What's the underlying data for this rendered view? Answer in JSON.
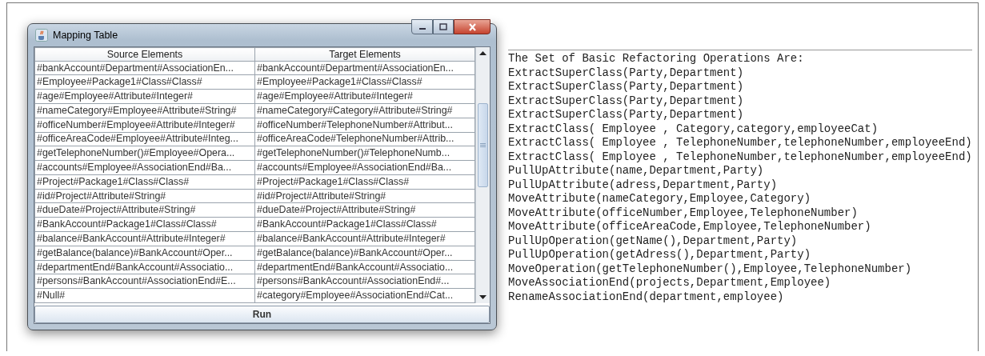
{
  "window": {
    "title": "Mapping Table"
  },
  "table": {
    "columns": [
      "Source Elements",
      "Target Elements"
    ],
    "rows": [
      [
        "#bankAccount#Department#AssociationEn...",
        "#bankAccount#Department#AssociationEn..."
      ],
      [
        "#Employee#Package1#Class#Class#",
        "#Employee#Package1#Class#Class#"
      ],
      [
        "#age#Employee#Attribute#Integer#",
        "#age#Employee#Attribute#Integer#"
      ],
      [
        "#nameCategory#Employee#Attribute#String#",
        "#nameCategory#Category#Attribute#String#"
      ],
      [
        "#officeNumber#Employee#Attribute#Integer#",
        "#officeNumber#TelephoneNumber#Attribut..."
      ],
      [
        "#officeAreaCode#Employee#Attribute#Integ...",
        "#officeAreaCode#TelephoneNumber#Attrib..."
      ],
      [
        "#getTelephoneNumber()#Employee#Opera...",
        "#getTelephoneNumber()#TelephoneNumb..."
      ],
      [
        "#accounts#Employee#AssociationEnd#Ba...",
        "#accounts#Employee#AssociationEnd#Ba..."
      ],
      [
        "#Project#Package1#Class#Class#",
        "#Project#Package1#Class#Class#"
      ],
      [
        "#id#Project#Attribute#String#",
        "#id#Project#Attribute#String#"
      ],
      [
        "#dueDate#Project#Attribute#String#",
        "#dueDate#Project#Attribute#String#"
      ],
      [
        "#BankAccount#Package1#Class#Class#",
        "#BankAccount#Package1#Class#Class#"
      ],
      [
        "#balance#BankAccount#Attribute#Integer#",
        "#balance#BankAccount#Attribute#Integer#"
      ],
      [
        "#getBalance(balance)#BankAccount#Oper...",
        "#getBalance(balance)#BankAccount#Oper..."
      ],
      [
        "#departmentEnd#BankAccount#Associatio...",
        "#departmentEnd#BankAccount#Associatio..."
      ],
      [
        "#persons#BankAccount#AssociationEnd#E...",
        "#persons#BankAccount#AssociationEnd#..."
      ],
      [
        "#Null#",
        "#category#Employee#AssociationEnd#Cat..."
      ]
    ]
  },
  "run_button": {
    "label": "Run"
  },
  "output": {
    "heading": "The Set of Basic Refactoring Operations Are:",
    "lines": [
      "ExtractSuperClass(Party,Department)",
      "ExtractSuperClass(Party,Department)",
      "ExtractSuperClass(Party,Department)",
      "ExtractSuperClass(Party,Department)",
      "ExtractClass( Employee , Category,category,employeeCat)",
      "ExtractClass( Employee , TelephoneNumber,telephoneNumber,employeeEnd)",
      "ExtractClass( Employee , TelephoneNumber,telephoneNumber,employeeEnd)",
      "PullUpAttribute(name,Department,Party)",
      "PullUpAttribute(adress,Department,Party)",
      "MoveAttribute(nameCategory,Employee,Category)",
      "MoveAttribute(officeNumber,Employee,TelephoneNumber)",
      "MoveAttribute(officeAreaCode,Employee,TelephoneNumber)",
      "PullUpOperation(getName(),Department,Party)",
      "PullUpOperation(getAdress(),Department,Party)",
      "MoveOperation(getTelephoneNumber(),Employee,TelephoneNumber)",
      "MoveAssociationEnd(projects,Department,Employee)",
      "RenameAssociationEnd(department,employee)"
    ]
  }
}
